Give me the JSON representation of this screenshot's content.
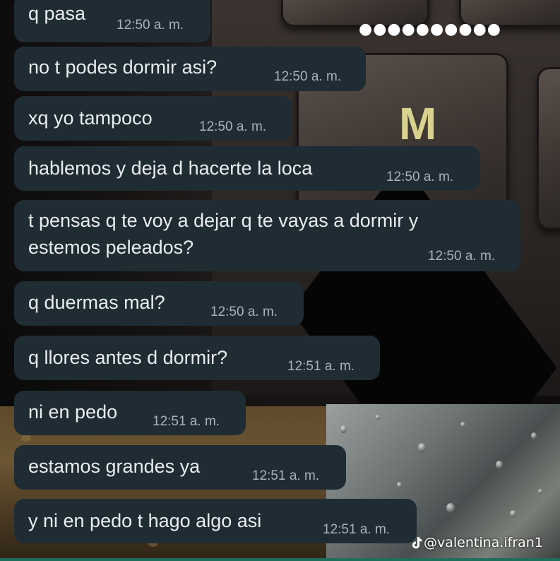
{
  "status": {
    "dots": "●●●●●●●●●●"
  },
  "background": {
    "key_label": "M"
  },
  "messages": [
    {
      "text": "q pasa",
      "time": "12:50 a. m."
    },
    {
      "text": "no t podes dormir asi?",
      "time": "12:50 a. m."
    },
    {
      "text": "xq yo tampoco",
      "time": "12:50 a. m."
    },
    {
      "text": "hablemos y deja d hacerte la loca",
      "time": "12:50 a. m."
    },
    {
      "text_line1": "t pensas q te voy a dejar q te vayas a dormir y",
      "text_line2": "estemos peleados?",
      "time": "12:50 a. m."
    },
    {
      "text": "q duermas mal?",
      "time": "12:50 a. m."
    },
    {
      "text": "q llores antes d dormir?",
      "time": "12:51 a. m."
    },
    {
      "text": "ni en pedo",
      "time": "12:51 a. m."
    },
    {
      "text": "estamos grandes ya",
      "time": "12:51 a. m."
    },
    {
      "text": "y ni en pedo t hago algo asi",
      "time": "12:51 a. m."
    }
  ],
  "watermark": {
    "handle": "@valentina.ifran1",
    "icon": "tiktok-icon"
  },
  "colors": {
    "bubble": "#1f2c33",
    "text": "#e9edef",
    "time": "#a9b3b8"
  }
}
